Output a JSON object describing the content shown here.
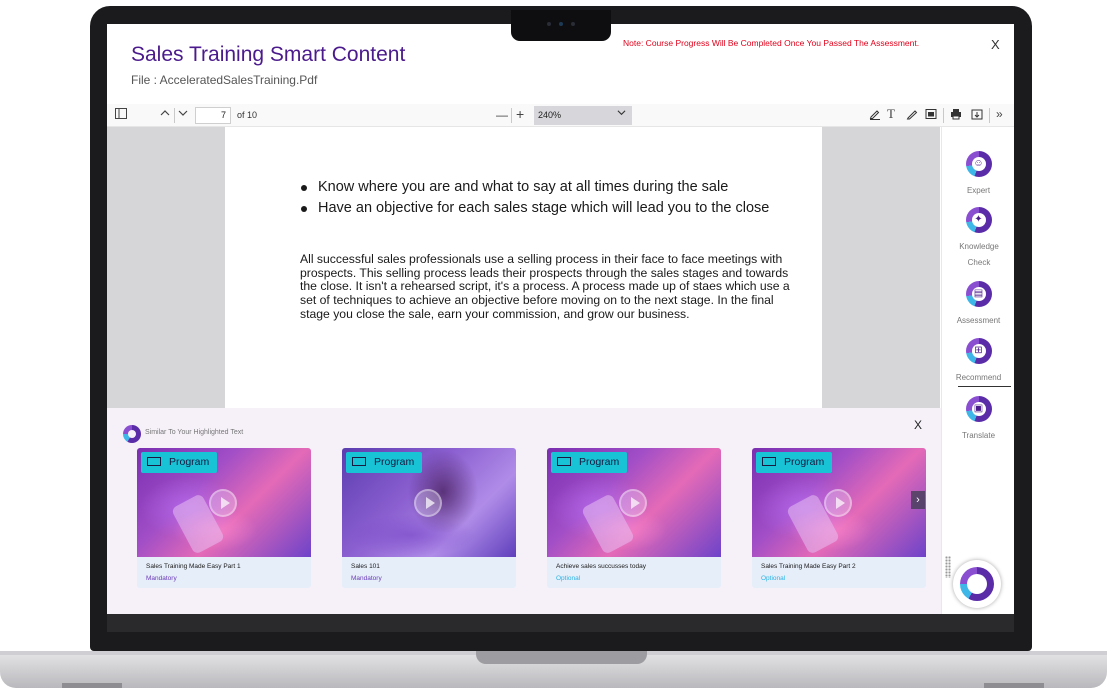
{
  "header": {
    "title": "Sales Training Smart Content",
    "file": "File : AcceleratedSalesTraining.Pdf",
    "note": "Note: Course Progress Will Be Completed Once You Passed The Assessment.",
    "close": "X"
  },
  "toolbar": {
    "page_current": "7",
    "page_total": "of 10",
    "zoom": "240%",
    "zoom_minus": "—",
    "zoom_plus": "+"
  },
  "document": {
    "bullets": [
      "Know where you are and what to say at all times during the sale",
      "Have an objective for each sales stage which will lead you to the close"
    ],
    "paragraph": "All successful sales professionals use a selling process in their face to face meetings with prospects. This selling process leads their prospects through the sales stages and towards the close. It isn't a rehearsed script, it's a process. A process made up of staes which use a set of techniques to achieve an objective before moving on to the next stage. In the final stage you close the sale, earn your commission, and grow our business."
  },
  "rail": {
    "items": [
      {
        "label": "Expert",
        "icon": "expert-icon"
      },
      {
        "label": "Knowledge Check",
        "icon": "bulb-icon"
      },
      {
        "label": "Assessment",
        "icon": "clipboard-icon"
      },
      {
        "label": "Recommend",
        "icon": "recommend-icon"
      },
      {
        "label": "Translate",
        "icon": "translate-icon"
      }
    ]
  },
  "similar": {
    "title": "Similar To Your Highlighted Text",
    "close": "X",
    "cards": [
      {
        "badge": "Program",
        "name": "Sales Training Made Easy Part 1",
        "tag": "Mandatory",
        "tag_color": "#6a3ab8"
      },
      {
        "badge": "Program",
        "name": "Sales 101",
        "tag": "Mandatory",
        "tag_color": "#6a3ab8"
      },
      {
        "badge": "Program",
        "name": "Achieve sales succusses today",
        "tag": "Optional",
        "tag_color": "#2ab3e6"
      },
      {
        "badge": "Program",
        "name": "Sales Training Made Easy Part 2",
        "tag": "Optional",
        "tag_color": "#2ab3e6"
      }
    ]
  },
  "colors": {
    "brand_purple": "#4b1a8c",
    "note_red": "#e2001a",
    "badge_cyan": "#18c3d6"
  }
}
